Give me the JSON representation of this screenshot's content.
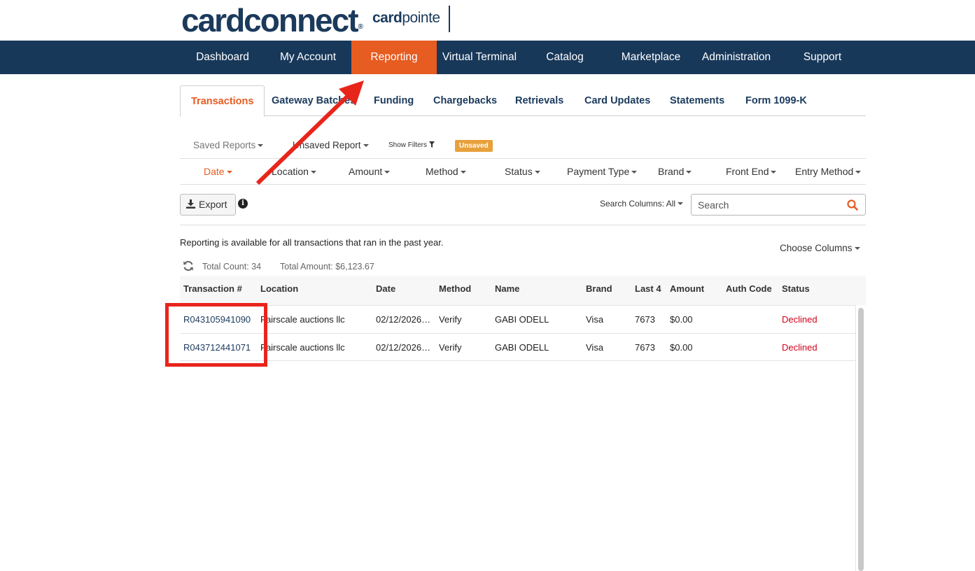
{
  "brand": {
    "logo_main": "cardconnect",
    "logo_sub_bold": "card",
    "logo_sub_rest": "pointe",
    "accent_color": "#e65c21",
    "nav_color": "#18385a"
  },
  "main_nav": {
    "items": [
      "Dashboard",
      "My Account",
      "Reporting",
      "Virtual Terminal",
      "Catalog",
      "Marketplace",
      "Administration",
      "Support"
    ],
    "active": "Reporting"
  },
  "sub_tabs": {
    "items": [
      "Transactions",
      "Gateway Batches",
      "Funding",
      "Chargebacks",
      "Retrievals",
      "Card Updates",
      "Statements",
      "Form 1099-K"
    ],
    "active": "Transactions"
  },
  "report_bar": {
    "saved_reports": "Saved Reports",
    "unsaved_report": "Unsaved Report",
    "show_filters": "Show Filters",
    "badge": "Unsaved"
  },
  "filters": [
    "Date",
    "Location",
    "Amount",
    "Method",
    "Status",
    "Payment Type",
    "Brand",
    "Front End",
    "Entry Method"
  ],
  "toolbar": {
    "export_label": "Export",
    "search_columns_label": "Search Columns:",
    "search_columns_value": "All",
    "search_placeholder": "Search"
  },
  "info": {
    "availability": "Reporting is available for all transactions that ran in the past year.",
    "choose_columns": "Choose Columns",
    "total_count": "Total Count: 34",
    "total_amount": "Total Amount: $6,123.67"
  },
  "table": {
    "columns": [
      "Transaction #",
      "Location",
      "Date",
      "Method",
      "Name",
      "Brand",
      "Last 4",
      "Amount",
      "Auth Code",
      "Status"
    ],
    "rows": [
      [
        "R043105941090",
        "Fairscale auctions llc",
        "02/12/2026…",
        "Verify",
        "GABI ODELL",
        "Visa",
        "7673",
        "$0.00",
        "",
        "Declined"
      ],
      [
        "R043712441071",
        "Fairscale auctions llc",
        "02/12/2026…",
        "Verify",
        "GABI ODELL",
        "Visa",
        "7673",
        "$0.00",
        "",
        "Declined"
      ]
    ],
    "status_color": "#d0021b"
  }
}
